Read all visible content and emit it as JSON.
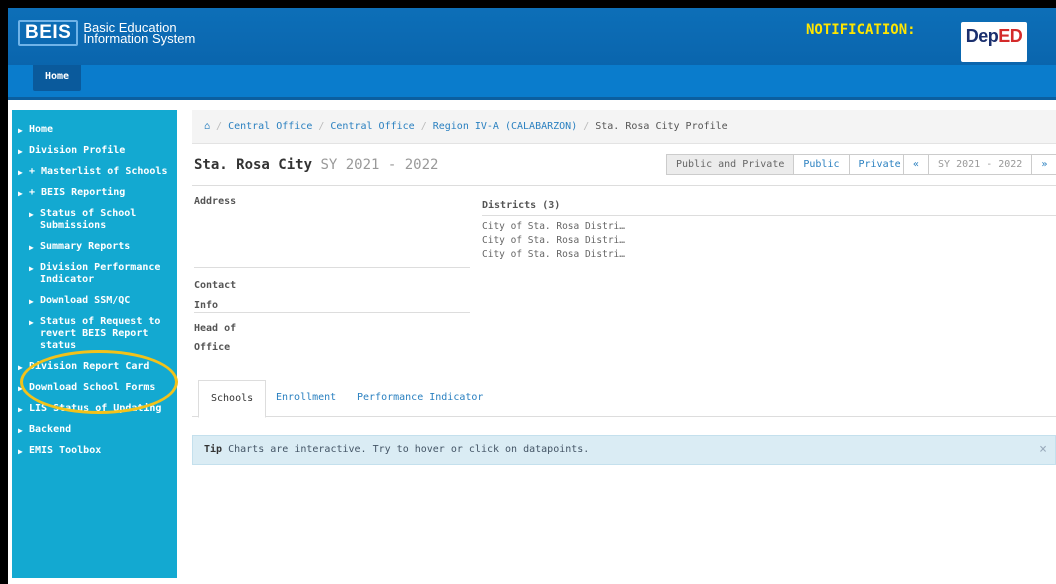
{
  "header": {
    "logo_short": "BEIS",
    "logo_line1": "Basic Education",
    "logo_line2": "Information System",
    "notification_label": "NOTIFICATION:",
    "deped_logo": "DepED"
  },
  "navbar": {
    "home_label": "Home"
  },
  "sidebar": {
    "items": [
      {
        "label": "Home"
      },
      {
        "label": "Division Profile"
      },
      {
        "label": "+ Masterlist of Schools"
      },
      {
        "label": "+ BEIS Reporting"
      },
      {
        "label": "Status of School Submissions"
      },
      {
        "label": "Summary Reports"
      },
      {
        "label": "Division Performance Indicator"
      },
      {
        "label": "Download SSM/QC"
      },
      {
        "label": "Status of Request to revert BEIS Report status"
      },
      {
        "label": "Division Report Card"
      },
      {
        "label": "Download School Forms"
      },
      {
        "label": "LIS Status of Updating"
      },
      {
        "label": "Backend"
      },
      {
        "label": "EMIS Toolbox"
      }
    ]
  },
  "breadcrumb": {
    "home_icon": "⌂",
    "items": [
      "Central Office",
      "Central Office",
      "Region IV-A (CALABARZON)"
    ],
    "current": "Sta. Rosa City Profile"
  },
  "page": {
    "title": "Sta. Rosa City",
    "sy": "SY 2021 - 2022"
  },
  "filters": {
    "public_and_private": "Public and Private",
    "public": "Public",
    "private": "Private",
    "prev": "«",
    "sy": "SY 2021 - 2022",
    "next": "»"
  },
  "info": {
    "address_label": "Address",
    "contact_label_1": "Contact",
    "contact_label_2": "Info",
    "head_label_1": "Head of",
    "head_label_2": "Office",
    "districts_label": "Districts (3)",
    "districts": [
      "City of Sta. Rosa Distri…",
      "City of Sta. Rosa Distri…",
      "City of Sta. Rosa Distri…"
    ]
  },
  "tabs": {
    "schools": "Schools",
    "enrollment": "Enrollment",
    "performance": "Performance Indicator"
  },
  "tip": {
    "label": "Tip",
    "text": "Charts are interactive. Try to hover or click on datapoints.",
    "close": "×"
  },
  "colors": {
    "header_blue": "#0a6db5",
    "sidebar_blue": "#13a9d1",
    "notification_yellow": "#ffe600",
    "highlight_circle": "#f2c21a",
    "link": "#2a80c0"
  }
}
